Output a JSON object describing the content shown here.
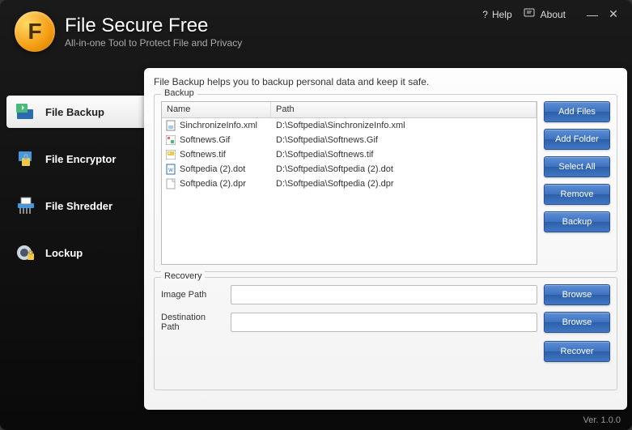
{
  "header": {
    "app_title": "File Secure Free",
    "app_subtitle": "All-in-one Tool to Protect File and Privacy",
    "logo_letter": "F",
    "help_label": "Help",
    "about_label": "About"
  },
  "sidebar": {
    "items": [
      {
        "label": "File Backup",
        "icon": "backup-icon"
      },
      {
        "label": "File Encryptor",
        "icon": "encryptor-icon"
      },
      {
        "label": "File Shredder",
        "icon": "shredder-icon"
      },
      {
        "label": "Lockup",
        "icon": "lockup-icon"
      }
    ]
  },
  "main": {
    "description": "File Backup helps you to backup personal data and keep it safe.",
    "backup_label": "Backup",
    "recovery_label": "Recovery",
    "columns": {
      "name": "Name",
      "path": "Path"
    },
    "files": [
      {
        "name": "SinchronizeInfo.xml",
        "path": "D:\\Softpedia\\SinchronizeInfo.xml",
        "icon": "xml-file-icon"
      },
      {
        "name": "Softnews.Gif",
        "path": "D:\\Softpedia\\Softnews.Gif",
        "icon": "gif-file-icon"
      },
      {
        "name": "Softnews.tif",
        "path": "D:\\Softpedia\\Softnews.tif",
        "icon": "tif-file-icon"
      },
      {
        "name": "Softpedia (2).dot",
        "path": "D:\\Softpedia\\Softpedia (2).dot",
        "icon": "doc-file-icon"
      },
      {
        "name": "Softpedia (2).dpr",
        "path": "D:\\Softpedia\\Softpedia (2).dpr",
        "icon": "generic-file-icon"
      }
    ],
    "buttons": {
      "add_files": "Add Files",
      "add_folder": "Add Folder",
      "select_all": "Select All",
      "remove": "Remove",
      "backup": "Backup",
      "browse": "Browse",
      "recover": "Recover"
    },
    "recovery": {
      "image_path_label": "Image Path",
      "destination_path_label": "Destination Path",
      "image_path_value": "",
      "destination_path_value": ""
    }
  },
  "footer": {
    "version": "Ver. 1.0.0"
  }
}
